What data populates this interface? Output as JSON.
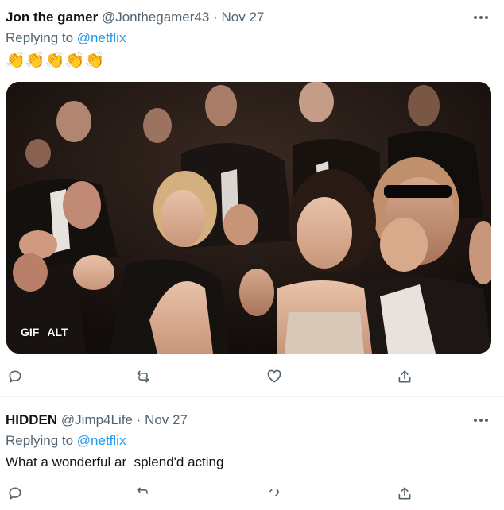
{
  "tweets": [
    {
      "display_name": "Jon the gamer",
      "handle": "@Jonthegamer43",
      "separator": "·",
      "date": "Nov 27",
      "replying_prefix": "Replying to ",
      "replying_to": "@netflix",
      "emoji_text": "👏👏👏👏👏",
      "media": {
        "badges": [
          "GIF",
          "ALT"
        ]
      }
    },
    {
      "display_name": "HIDDEN",
      "handle": "@Jimp4Life",
      "separator": "·",
      "date": "Nov 27",
      "replying_prefix": "Replying to ",
      "replying_to": "@netflix",
      "text": "What a wonderful ar  splend'd acting"
    }
  ],
  "icons": {
    "more": "more-horizontal-icon",
    "reply": "reply-bubble-icon",
    "retweet": "retweet-icon",
    "like": "heart-icon",
    "share": "share-icon"
  },
  "colors": {
    "text_primary": "#0f1419",
    "text_secondary": "#536471",
    "link": "#1d9bf0",
    "divider": "#eff3f4"
  }
}
